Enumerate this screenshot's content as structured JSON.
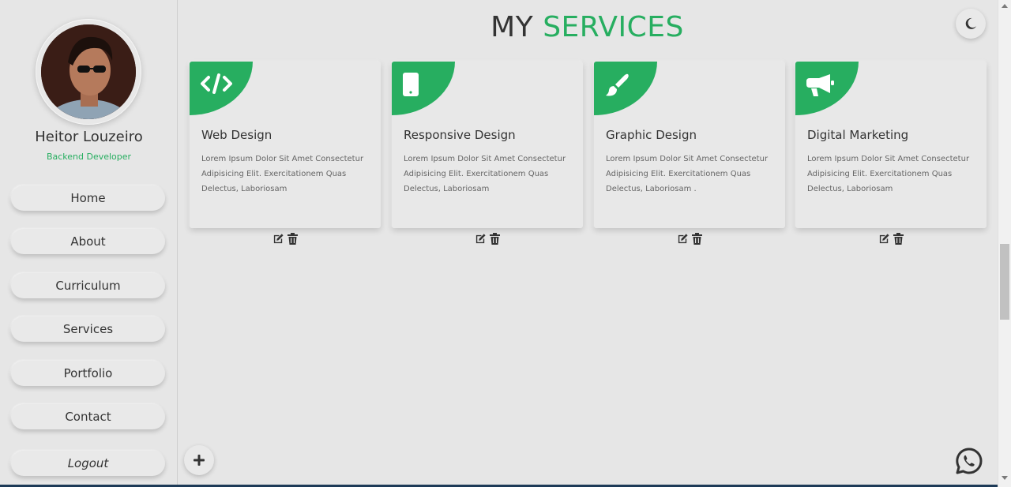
{
  "profile": {
    "name": "Heitor Louzeiro",
    "role": "Backend Developer"
  },
  "nav": {
    "items": [
      {
        "label": "Home"
      },
      {
        "label": "About"
      },
      {
        "label": "Curriculum"
      },
      {
        "label": "Services"
      },
      {
        "label": "Portfolio"
      },
      {
        "label": "Contact"
      }
    ],
    "logout": "Logout"
  },
  "header": {
    "title_part1": "MY",
    "title_part2": "SERVICES"
  },
  "services": [
    {
      "icon": "code-icon",
      "title": "Web Design",
      "text": "Lorem Ipsum Dolor Sit Amet Consectetur Adipisicing Elit. Exercitationem Quas Delectus, Laboriosam"
    },
    {
      "icon": "mobile-icon",
      "title": "Responsive Design",
      "text": "Lorem Ipsum Dolor Sit Amet Consectetur Adipisicing Elit. Exercitationem Quas Delectus, Laboriosam"
    },
    {
      "icon": "paint-brush-icon",
      "title": "Graphic Design",
      "text": "Lorem Ipsum Dolor Sit Amet Consectetur Adipisicing Elit. Exercitationem Quas Delectus, Laboriosam ."
    },
    {
      "icon": "megaphone-icon",
      "title": "Digital Marketing",
      "text": "Lorem Ipsum Dolor Sit Amet Consectetur Adipisicing Elit. Exercitationem Quas Delectus, Laboriosam"
    }
  ],
  "colors": {
    "accent": "#27ae60",
    "background": "#e6e6e6",
    "text": "#333333"
  }
}
